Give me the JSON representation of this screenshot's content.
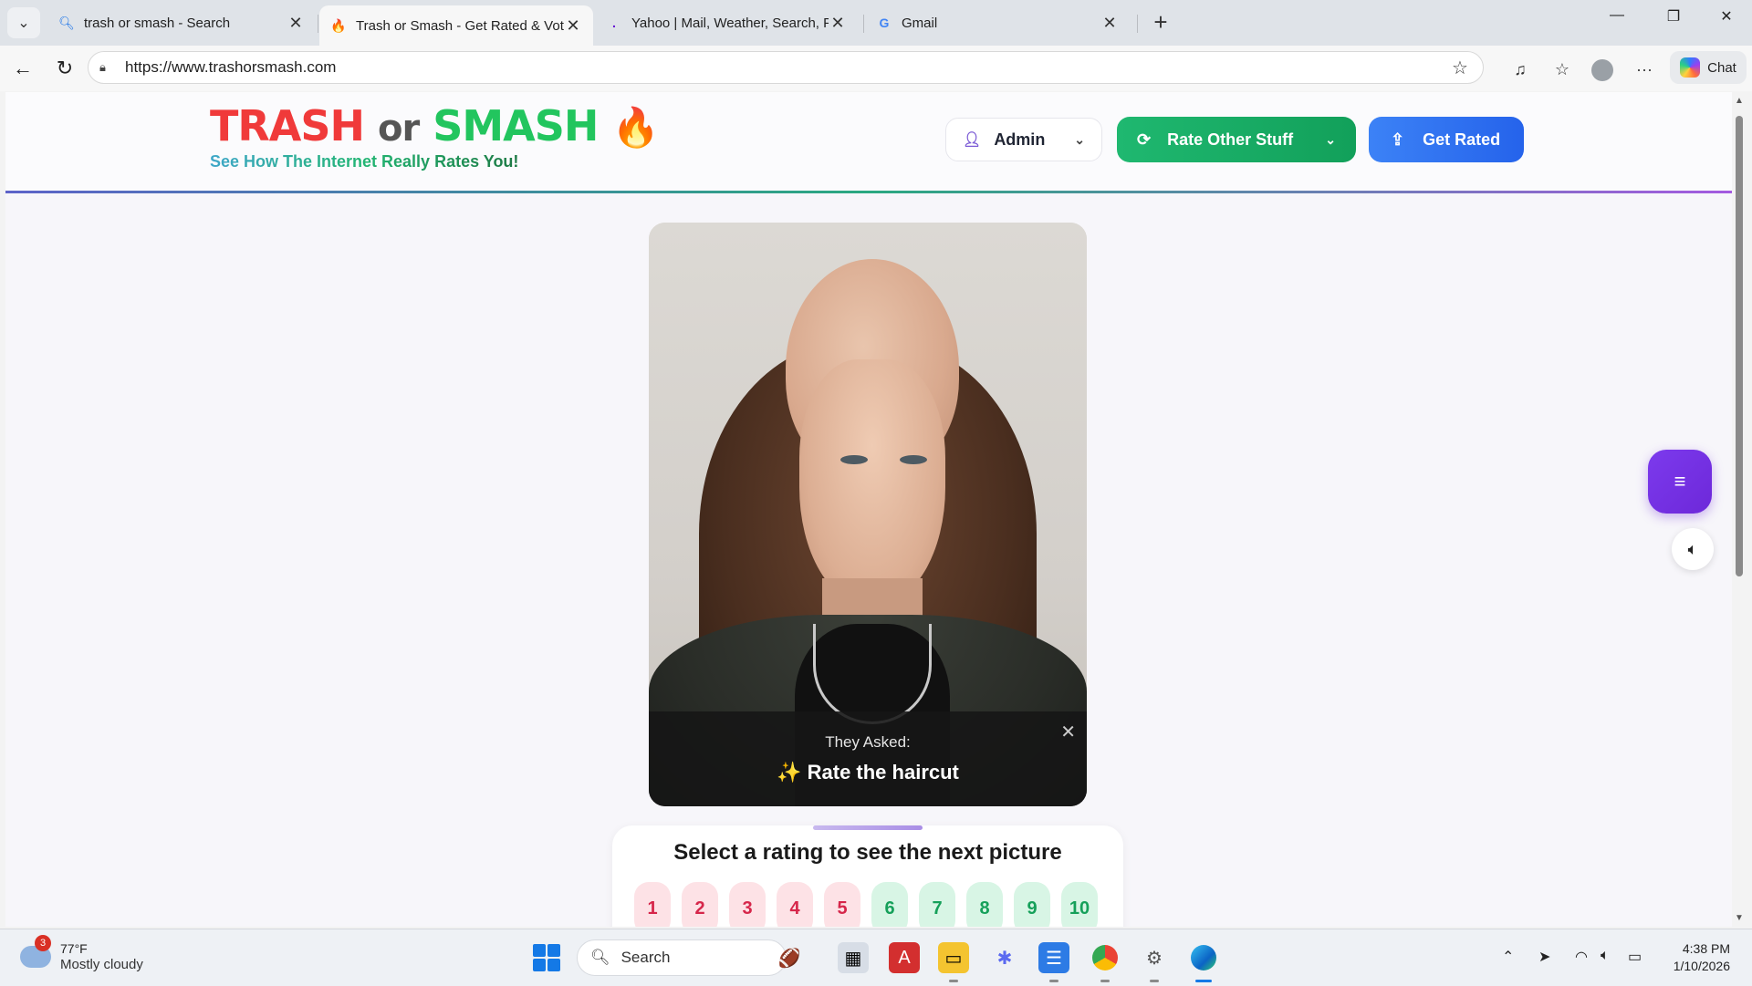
{
  "browser": {
    "tabs": [
      {
        "title": "trash or smash - Search",
        "icon": "search-icon",
        "active": false
      },
      {
        "title": "Trash or Smash - Get Rated & Vote",
        "icon": "flame-icon",
        "active": true
      },
      {
        "title": "Yahoo | Mail, Weather, Search, Politics",
        "icon": "yahoo-icon",
        "active": false
      },
      {
        "title": "Gmail",
        "icon": "google-icon",
        "active": false
      }
    ],
    "url": "https://www.trashorsmash.com",
    "chat_label": "Chat"
  },
  "site": {
    "logo": {
      "trash": "TRASH",
      "or": "or",
      "smash": "SMASH",
      "flame": "🔥"
    },
    "tagline": "See How The Internet Really Rates You!",
    "admin_label": "Admin",
    "rate_other_label": "Rate Other Stuff",
    "get_rated_label": "Get Rated",
    "accent_colors": {
      "trash": "#f03a3a",
      "smash": "#22c55e",
      "rate_other": "#1fb870",
      "get_rated": "#3c82f6",
      "menu_fab": "#7c3aed"
    }
  },
  "card": {
    "caption_heading": "They Asked:",
    "caption_sparkle": "✨",
    "caption_text": "Rate the haircut"
  },
  "rating": {
    "title": "Select a rating to see the next picture",
    "options": [
      "1",
      "2",
      "3",
      "4",
      "5",
      "6",
      "7",
      "8",
      "9",
      "10"
    ]
  },
  "taskbar": {
    "weather_badge": "3",
    "temperature": "77°F",
    "condition": "Mostly cloudy",
    "search_label": "Search",
    "time": "4:38 PM",
    "date": "1/10/2026"
  }
}
